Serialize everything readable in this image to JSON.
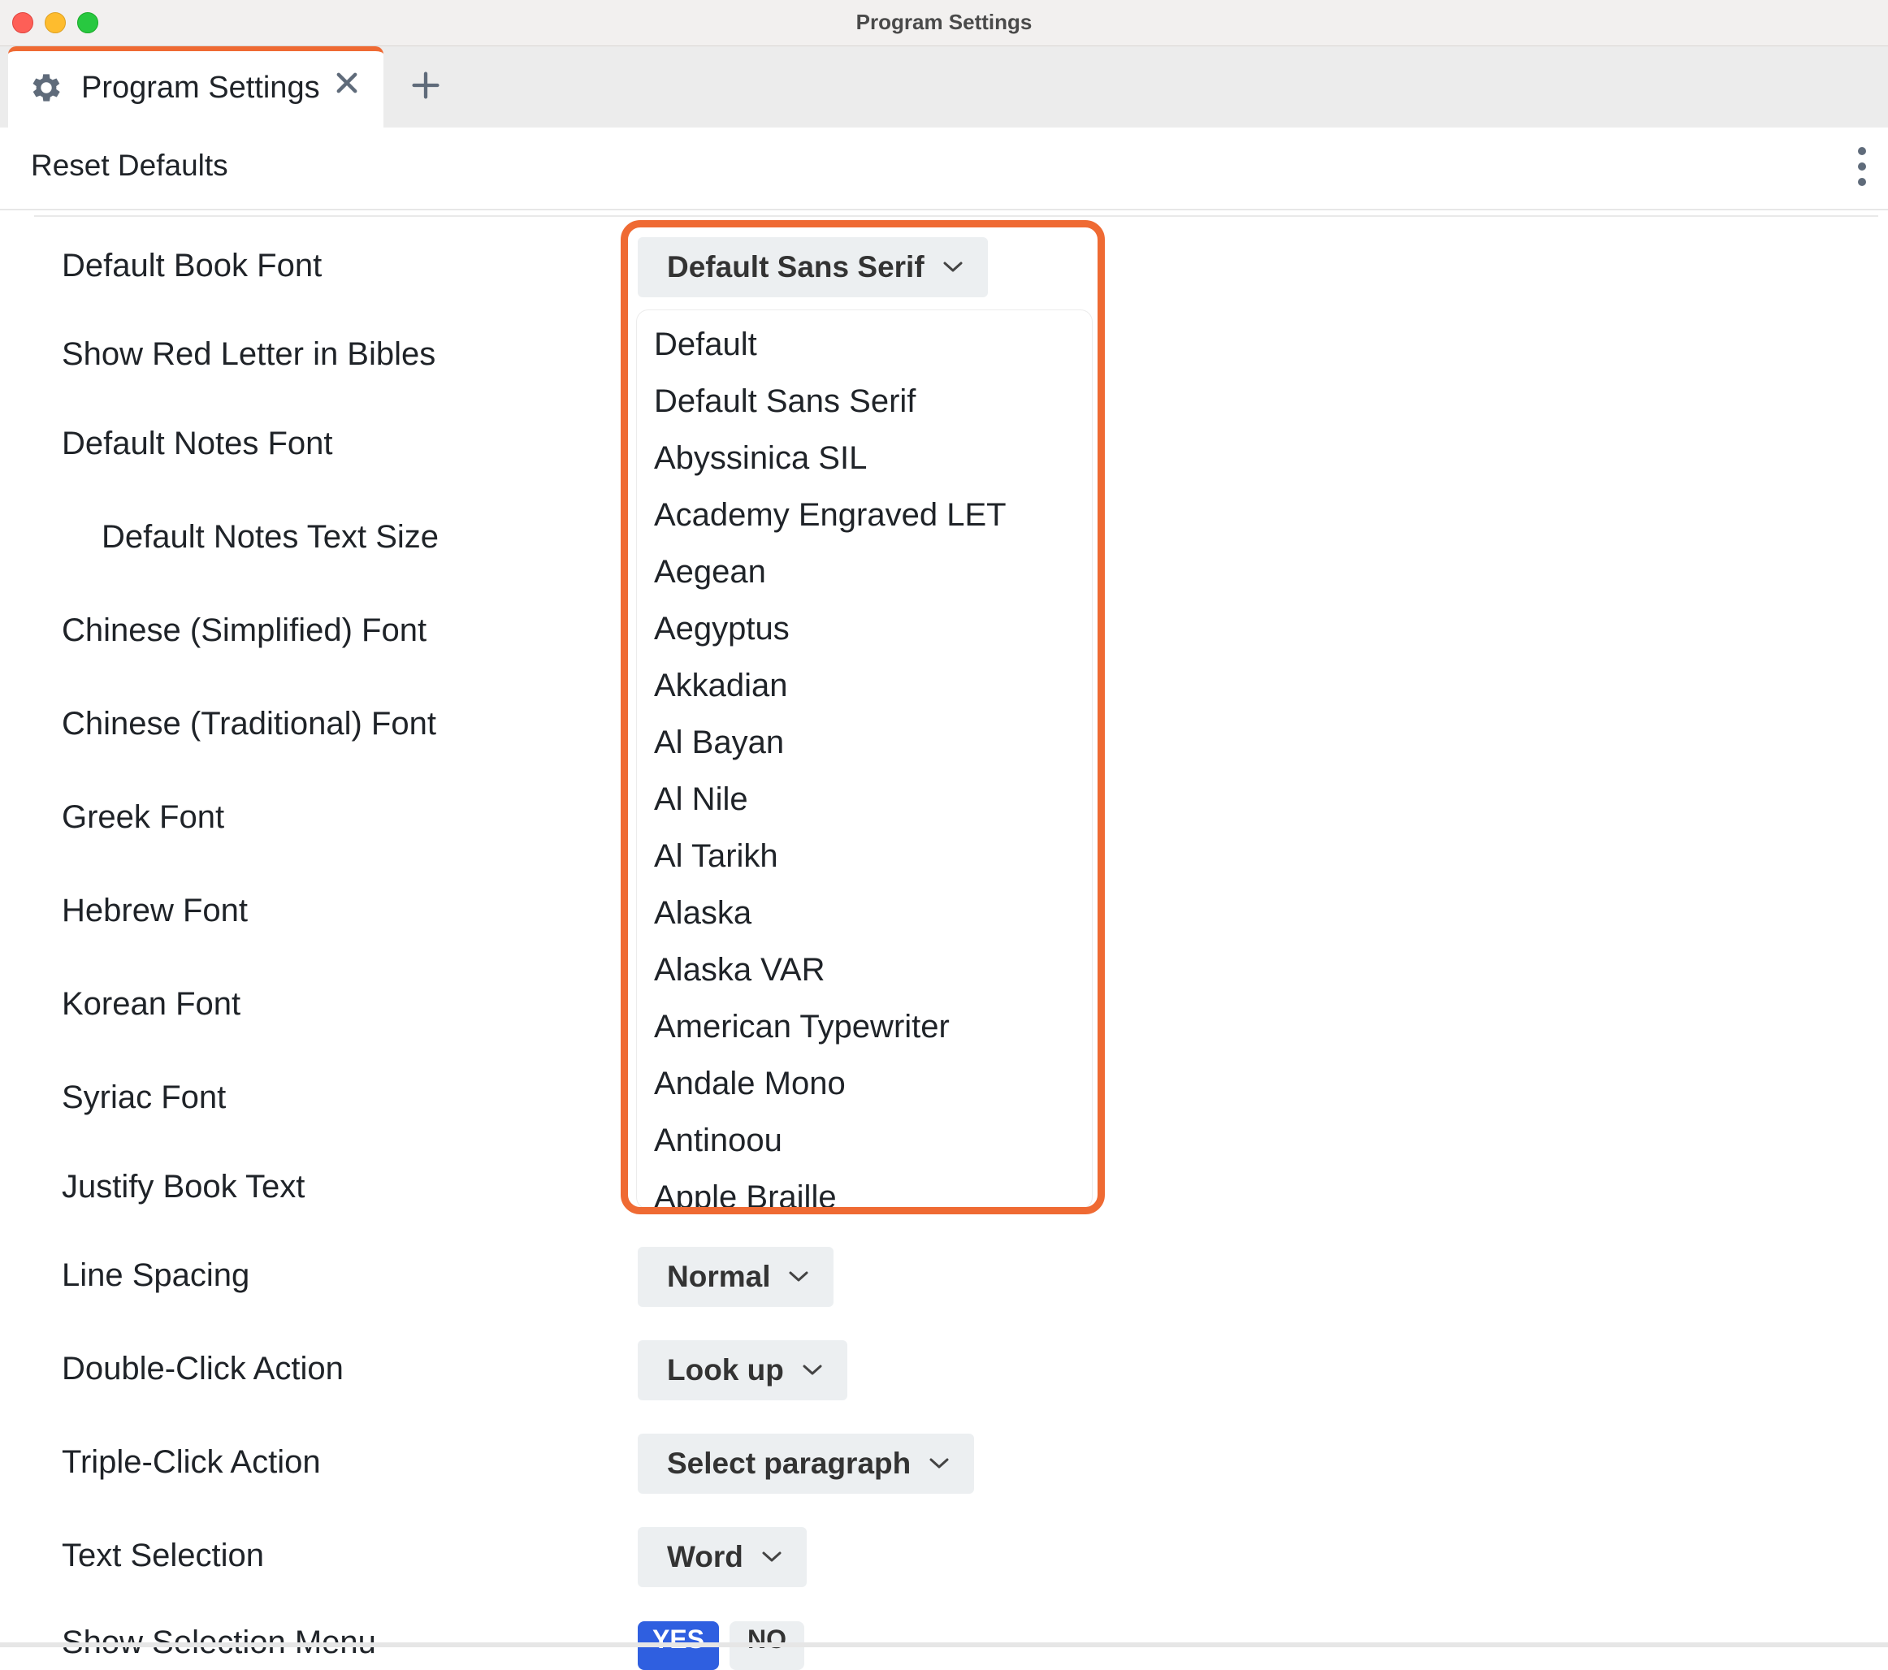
{
  "window": {
    "title": "Program Settings"
  },
  "tab": {
    "label": "Program Settings",
    "icon": "gear-icon"
  },
  "toolbar": {
    "reset_label": "Reset Defaults"
  },
  "settings": {
    "labels": [
      "Default Book Font",
      "Show Red Letter in Bibles",
      "Default Notes Font",
      "Default Notes Text Size",
      "Chinese (Simplified) Font",
      "Chinese (Traditional) Font",
      "Greek Font",
      "Hebrew Font",
      "Korean Font",
      "Syriac Font",
      "Justify Book Text",
      "Line Spacing",
      "Double-Click Action",
      "Triple-Click Action",
      "Text Selection",
      "Show Selection Menu"
    ],
    "book_font_value": "Default Sans Serif",
    "line_spacing_value": "Normal",
    "double_click_value": "Look up",
    "triple_click_value": "Select paragraph",
    "text_selection_value": "Word",
    "selection_menu_yes": "YES",
    "selection_menu_no": "NO"
  },
  "font_menu": {
    "items": [
      "Default",
      "Default Sans Serif",
      "Abyssinica SIL",
      "Academy Engraved LET",
      "Aegean",
      "Aegyptus",
      "Akkadian",
      "Al Bayan",
      "Al Nile",
      "Al Tarikh",
      "Alaska",
      "Alaska VAR",
      "American Typewriter",
      "Andale Mono",
      "Antinoou",
      "Apple Braille"
    ]
  },
  "colors": {
    "accent": "#ef6a33",
    "primary_button": "#2f5fe0",
    "dropdown_bg": "#eceff1"
  }
}
